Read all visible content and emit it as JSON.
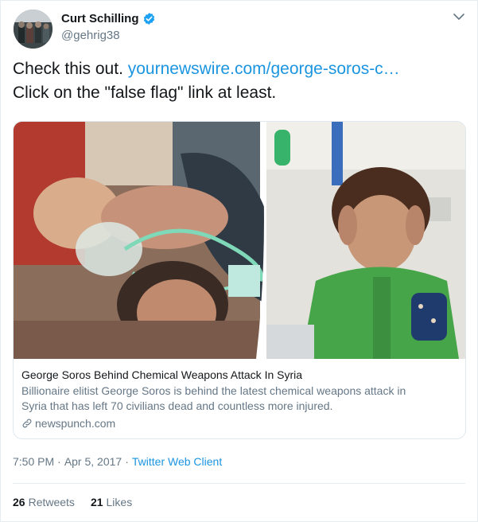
{
  "user": {
    "display_name": "Curt Schilling",
    "handle": "@gehrig38"
  },
  "tweet": {
    "text_line1": "Check this out. ",
    "link_text": "yournewswire.com/george-soros-c…",
    "text_line2": "Click on the \"false flag\" link at least."
  },
  "card": {
    "title": "George Soros Behind Chemical Weapons Attack In Syria",
    "description_line1": "Billionaire elitist George Soros is behind the latest chemical weapons attack in",
    "description_line2": "Syria that has left 70 civilians dead and countless more injured.",
    "domain": "newspunch.com"
  },
  "meta": {
    "time": "7:50 PM",
    "separator1": "·",
    "date": "Apr 5, 2017",
    "separator2": "·",
    "client": "Twitter Web Client"
  },
  "stats": {
    "retweets_count": "26",
    "retweets_label": "Retweets",
    "likes_count": "21",
    "likes_label": "Likes"
  },
  "icons": [
    "verified-badge-icon",
    "chevron-down-icon",
    "link-icon"
  ],
  "colors": {
    "accent": "#1b95e0",
    "secondary_text": "#657786",
    "verified": "#1da1f2"
  }
}
